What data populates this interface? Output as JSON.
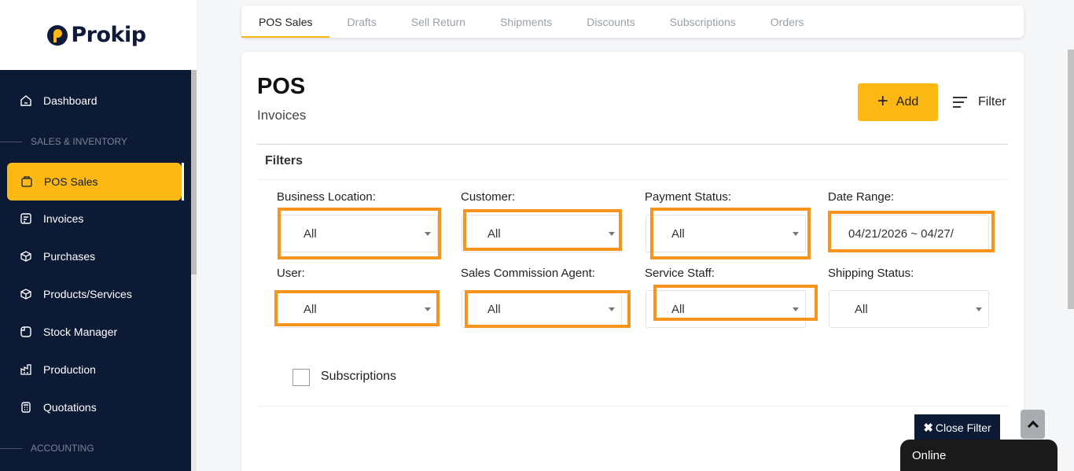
{
  "brand": {
    "name": "Prokip"
  },
  "sidebar": {
    "items": [
      {
        "label": "Dashboard",
        "icon": "home-icon"
      },
      {
        "section": "SALES & INVENTORY"
      },
      {
        "label": "POS Sales",
        "icon": "pos-icon",
        "active": true
      },
      {
        "label": "Invoices",
        "icon": "invoice-icon"
      },
      {
        "label": "Purchases",
        "icon": "purchase-icon"
      },
      {
        "label": "Products/Services",
        "icon": "box-icon"
      },
      {
        "label": "Stock Manager",
        "icon": "stock-icon"
      },
      {
        "label": "Production",
        "icon": "factory-icon"
      },
      {
        "label": "Quotations",
        "icon": "calculator-icon"
      },
      {
        "section": "ACCOUNTING"
      }
    ]
  },
  "tabs": [
    "POS Sales",
    "Drafts",
    "Sell Return",
    "Shipments",
    "Discounts",
    "Subscriptions",
    "Orders"
  ],
  "active_tab": "POS Sales",
  "page": {
    "title": "POS",
    "subtitle": "Invoices",
    "add_label": "Add",
    "filter_label": "Filter"
  },
  "filters": {
    "title": "Filters",
    "fields": [
      {
        "label": "Business Location:",
        "value": "All"
      },
      {
        "label": "Customer:",
        "value": "All"
      },
      {
        "label": "Payment Status:",
        "value": "All"
      },
      {
        "label": "Date Range:",
        "value": "04/21/2026 ~ 04/27/"
      },
      {
        "label": "User:",
        "value": "All"
      },
      {
        "label": "Sales Commission Agent:",
        "value": "All"
      },
      {
        "label": "Service Staff:",
        "value": "All"
      },
      {
        "label": "Shipping Status:",
        "value": "All"
      }
    ],
    "checkbox_label": "Subscriptions",
    "close_label": "Close Filter"
  },
  "chat": {
    "status": "Online"
  },
  "colors": {
    "accent": "#fdb813",
    "sidebar_bg": "#0c1a36",
    "highlight": "#f7941d"
  }
}
